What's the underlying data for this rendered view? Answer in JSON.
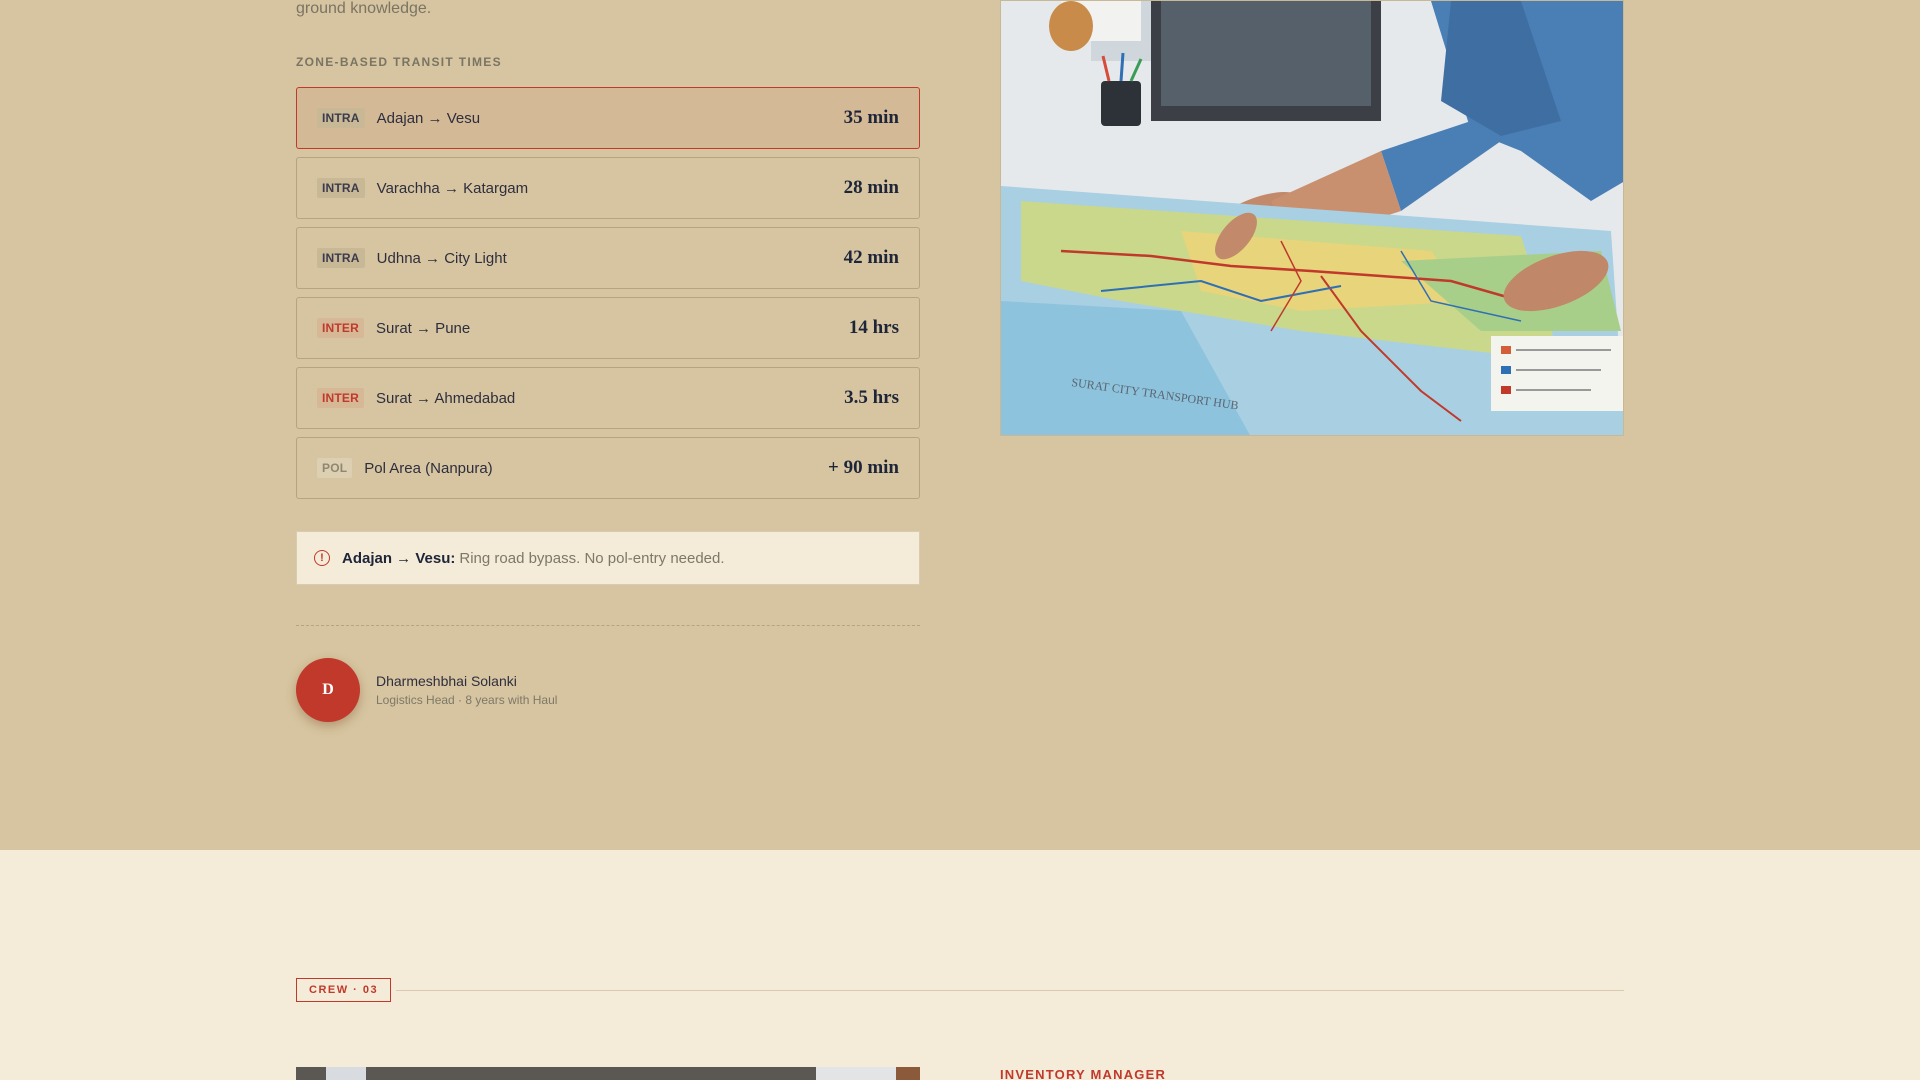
{
  "intro": {
    "tail_text": "ground knowledge."
  },
  "transit": {
    "section_label": "ZONE-BASED TRANSIT TIMES",
    "routes": [
      {
        "tag": "INTRA",
        "tag_type": "intra",
        "name": "Adajan → Vesu",
        "time": "35 min",
        "active": true
      },
      {
        "tag": "INTRA",
        "tag_type": "intra",
        "name": "Varachha → Katargam",
        "time": "28 min",
        "active": false
      },
      {
        "tag": "INTRA",
        "tag_type": "intra",
        "name": "Udhna → City Light",
        "time": "42 min",
        "active": false
      },
      {
        "tag": "INTER",
        "tag_type": "inter",
        "name": "Surat → Pune",
        "time": "14 hrs",
        "active": false
      },
      {
        "tag": "INTER",
        "tag_type": "inter",
        "name": "Surat → Ahmedabad",
        "time": "3.5 hrs",
        "active": false
      },
      {
        "tag": "POL",
        "tag_type": "pol",
        "name": "Pol Area (Nanpura)",
        "time": "+ 90 min",
        "active": false
      }
    ]
  },
  "notice": {
    "icon": "alert-circle-icon",
    "route": "Adajan → Vesu:",
    "text": "Ring road bypass. No pol-entry needed."
  },
  "author": {
    "initial": "D",
    "name": "Dharmeshbhai Solanki",
    "role": "Logistics Head · 8 years with Haul"
  },
  "photo": {
    "map_caption": "SURAT CITY TRANSPORT HUB"
  },
  "crew": {
    "badge": "CREW · 03",
    "role_label": "INVENTORY MANAGER"
  },
  "colors": {
    "accent": "#c0392b",
    "top_background": "#d6c5a0",
    "bottom_background": "#f4ebd9",
    "active_row": "#d3b996",
    "navy_text": "#1e2538"
  }
}
